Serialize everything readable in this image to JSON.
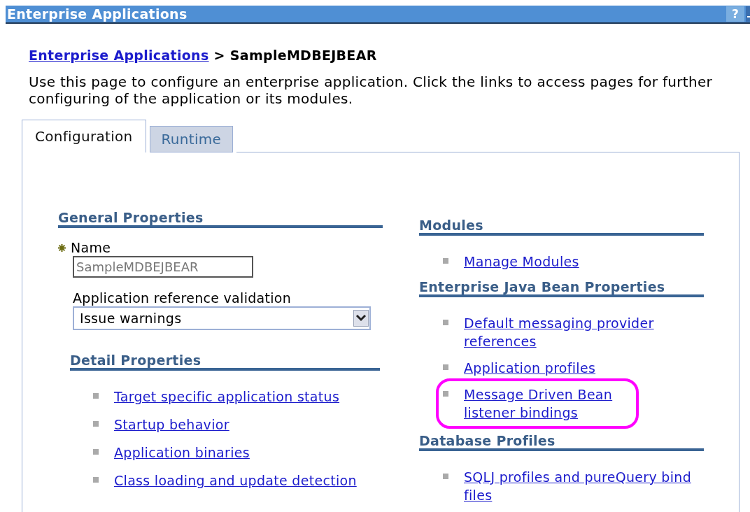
{
  "title_bar": {
    "title": "Enterprise Applications",
    "help": "?"
  },
  "breadcrumb": {
    "link": "Enterprise Applications",
    "separator": ">",
    "current": "SampleMDBEJBEAR"
  },
  "description": "Use this page to configure an enterprise application. Click the links to access pages for further configuring of the application or its modules.",
  "tabs": [
    {
      "label": "Configuration",
      "selected": true
    },
    {
      "label": "Runtime",
      "selected": false
    }
  ],
  "general_properties": {
    "heading": "General Properties",
    "name_field": {
      "label": "Name",
      "required": true,
      "value": "SampleMDBEJBEAR",
      "read_only": true
    },
    "validation_select": {
      "label": "Application reference validation",
      "value": "Issue warnings"
    }
  },
  "left_sections": [
    {
      "heading": "Detail Properties",
      "links": [
        {
          "text": "Target specific application status",
          "highlighted": false
        },
        {
          "text": "Startup behavior",
          "highlighted": false
        },
        {
          "text": "Application binaries",
          "highlighted": false
        },
        {
          "text": "Class loading and update detection",
          "highlighted": false
        }
      ]
    }
  ],
  "right_sections": [
    {
      "heading": "Modules",
      "links": [
        {
          "text": "Manage Modules",
          "highlighted": false
        }
      ]
    },
    {
      "heading": "Enterprise Java Bean Properties",
      "links": [
        {
          "text": "Default messaging provider references",
          "highlighted": false
        },
        {
          "text": "Application profiles",
          "highlighted": false
        },
        {
          "text": "Message Driven Bean listener bindings",
          "highlighted": true
        }
      ]
    },
    {
      "heading": "Database Profiles",
      "links": [
        {
          "text": "SQLJ profiles and pureQuery bind files",
          "highlighted": false
        }
      ]
    }
  ]
}
